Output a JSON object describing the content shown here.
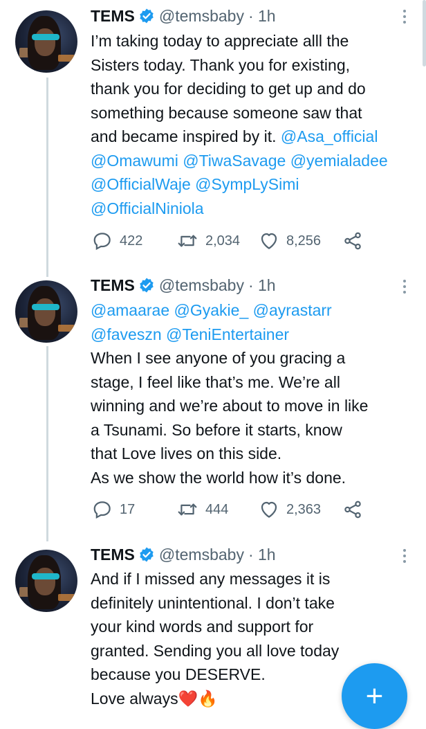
{
  "tweets": [
    {
      "name": "TEMS",
      "handle": "@temsbaby",
      "time": "· 1h",
      "lines": [
        [
          {
            "t": "I’m taking today to appreciate alll the",
            "m": false
          }
        ],
        [
          {
            "t": "Sisters today. Thank you for existing,",
            "m": false
          }
        ],
        [
          {
            "t": "thank you for deciding to get up and do",
            "m": false
          }
        ],
        [
          {
            "t": "something because someone saw that",
            "m": false
          }
        ],
        [
          {
            "t": "and became inspired by it. ",
            "m": false
          },
          {
            "t": "@Asa_official",
            "m": true
          }
        ],
        [
          {
            "t": "@Omawumi @TiwaSavage @yemialadee",
            "m": true
          }
        ],
        [
          {
            "t": "@OfficialWaje @SympLySimi",
            "m": true
          }
        ],
        [
          {
            "t": "@OfficialNiniola",
            "m": true
          }
        ]
      ],
      "replies": "422",
      "retweets": "2,034",
      "likes": "8,256"
    },
    {
      "name": "TEMS",
      "handle": "@temsbaby",
      "time": "· 1h",
      "lines": [
        [
          {
            "t": "@amaarae @Gyakie_ @ayrastarr",
            "m": true
          }
        ],
        [
          {
            "t": "@faveszn @TeniEntertainer",
            "m": true
          }
        ],
        [
          {
            "t": "When I see anyone of you gracing a",
            "m": false
          }
        ],
        [
          {
            "t": "stage, I feel like that’s me. We’re all",
            "m": false
          }
        ],
        [
          {
            "t": "winning and we’re about to move in like",
            "m": false
          }
        ],
        [
          {
            "t": "a Tsunami. So before it starts, know",
            "m": false
          }
        ],
        [
          {
            "t": "that Love lives on this side.",
            "m": false
          }
        ],
        [
          {
            "t": "As we show the world how it’s done.",
            "m": false
          }
        ]
      ],
      "replies": "17",
      "retweets": "444",
      "likes": "2,363"
    },
    {
      "name": "TEMS",
      "handle": "@temsbaby",
      "time": "· 1h",
      "lines": [
        [
          {
            "t": "And if I missed any messages it is",
            "m": false
          }
        ],
        [
          {
            "t": "definitely unintentional. I don’t take",
            "m": false
          }
        ],
        [
          {
            "t": "your kind words and support for",
            "m": false
          }
        ],
        [
          {
            "t": "granted. Sending you all love today",
            "m": false
          }
        ],
        [
          {
            "t": "because you DESERVE.",
            "m": false
          }
        ],
        [
          {
            "t": "Love always❤️🔥",
            "m": false
          }
        ]
      ]
    }
  ],
  "compose_label": "+",
  "colors": {
    "accent": "#1d9bf0",
    "text": "#0f1419",
    "muted": "#536471"
  }
}
